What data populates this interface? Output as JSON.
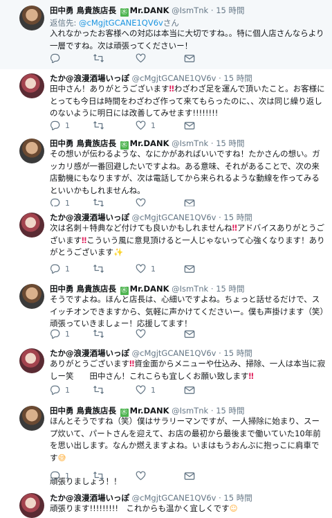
{
  "colors": {
    "accent": "#1b95e0",
    "text": "#14171a",
    "muted": "#657786",
    "highlight": "#e0245e",
    "first_bg": "#f5f8fa",
    "badge": "#4db34f"
  },
  "icons": {
    "reply": "reply-icon",
    "retweet": "retweet-icon",
    "like": "heart-icon",
    "dm": "envelope-icon",
    "badge": "mahjong-badge-icon"
  },
  "users": {
    "tanaka": {
      "name": "田中勇 鳥貴族店長",
      "badge": "㊌",
      "extra": "Mr.DANK",
      "handle": "@IsmTnk"
    },
    "taka": {
      "name": "たか@浪漫酒場いっぽ",
      "handle": "@cMgjtGCANE1QV6v"
    }
  },
  "tweets": [
    {
      "author": "tanaka",
      "time": "15 時間",
      "reply_prefix": "返信先:",
      "reply_handle": "@cMgjtGCANE1QV6v",
      "reply_suffix": "さん",
      "text": "入れなかったお客様への対応は本当に大切ですね。。特に個人店さんならより一層ですね。次は頑張ってくださいー！",
      "counts": {
        "reply": "",
        "retweet": "",
        "like": ""
      }
    },
    {
      "author": "taka",
      "time": "15 時間",
      "text_parts": [
        "田中さん！ありがとうございます",
        "‼",
        "わざわざ足を運んで頂いたこと。お客様にとっても今日は時間をわざわざ作って来てもらったのに、、次は同じ繰り返しのないように明日には改善してみせます!!!!!!!!"
      ],
      "counts": {
        "reply": "1",
        "retweet": "",
        "like": "1"
      }
    },
    {
      "author": "tanaka",
      "time": "15 時間",
      "text": "その想いが伝わるような、なにかがあればいいですね！たかさんの想い。ガッカリ感が一番回避したいですよね。ある意味、それがあることで、次の来店動機にもなりますが、次は電話してから来られるような動線を作ってみるといいかもしれませんね。",
      "counts": {
        "reply": "1",
        "retweet": "",
        "like": ""
      }
    },
    {
      "author": "taka",
      "time": "15 時間",
      "text_parts": [
        "次は名刺＋特典など付けても良いかもしれませんね",
        "‼",
        "アドバイスありがとうございます",
        "‼",
        "こういう風に意見頂けると一人じゃないって心強くなります！ありがとうございます",
        "✨"
      ],
      "counts": {
        "reply": "1",
        "retweet": "",
        "like": "1"
      }
    },
    {
      "author": "tanaka",
      "time": "15 時間",
      "text": "そうですよね。ほんと店長は、心細いですよね。ちょっと話せるだけで、スイッチオンできますから、気軽に声かけてくださいー。僕も声掛けます（笑）頑張っていきましょー！応援してます！",
      "counts": {
        "reply": "1",
        "retweet": "",
        "like": ""
      }
    },
    {
      "author": "taka",
      "time": "15 時間",
      "text_parts": [
        "ありがとうございます",
        "‼",
        "資金面からメニューや仕込み、掃除、一人は本当に寂しー笑　　田中さん！これこらも宜しくお願い致します",
        "‼"
      ],
      "counts": {
        "reply": "1",
        "retweet": "",
        "like": "1"
      }
    },
    {
      "author": "tanaka",
      "time": "15 時間",
      "text_parts": [
        "ほんとそうですね（笑）僕はサラリーマンですが、一人掃除に始まり、スープ炊いて、パートさんを迎えて、お店の最初から最後まで働いていた10年前を思い出します。なんか燃えますよね。いまはもうおんぶに抱っこに肩車です",
        "😅"
      ],
      "text_extra": "頑張りましょう！！",
      "counts": {
        "reply": "1",
        "retweet": "",
        "like": ""
      }
    },
    {
      "author": "taka",
      "time": "15 時間",
      "text_parts": [
        "頑張ります!!!!!!!!!　これからも温かく宜しくです",
        "☺"
      ],
      "counts": {
        "reply": "",
        "retweet": "",
        "like": ""
      }
    }
  ]
}
